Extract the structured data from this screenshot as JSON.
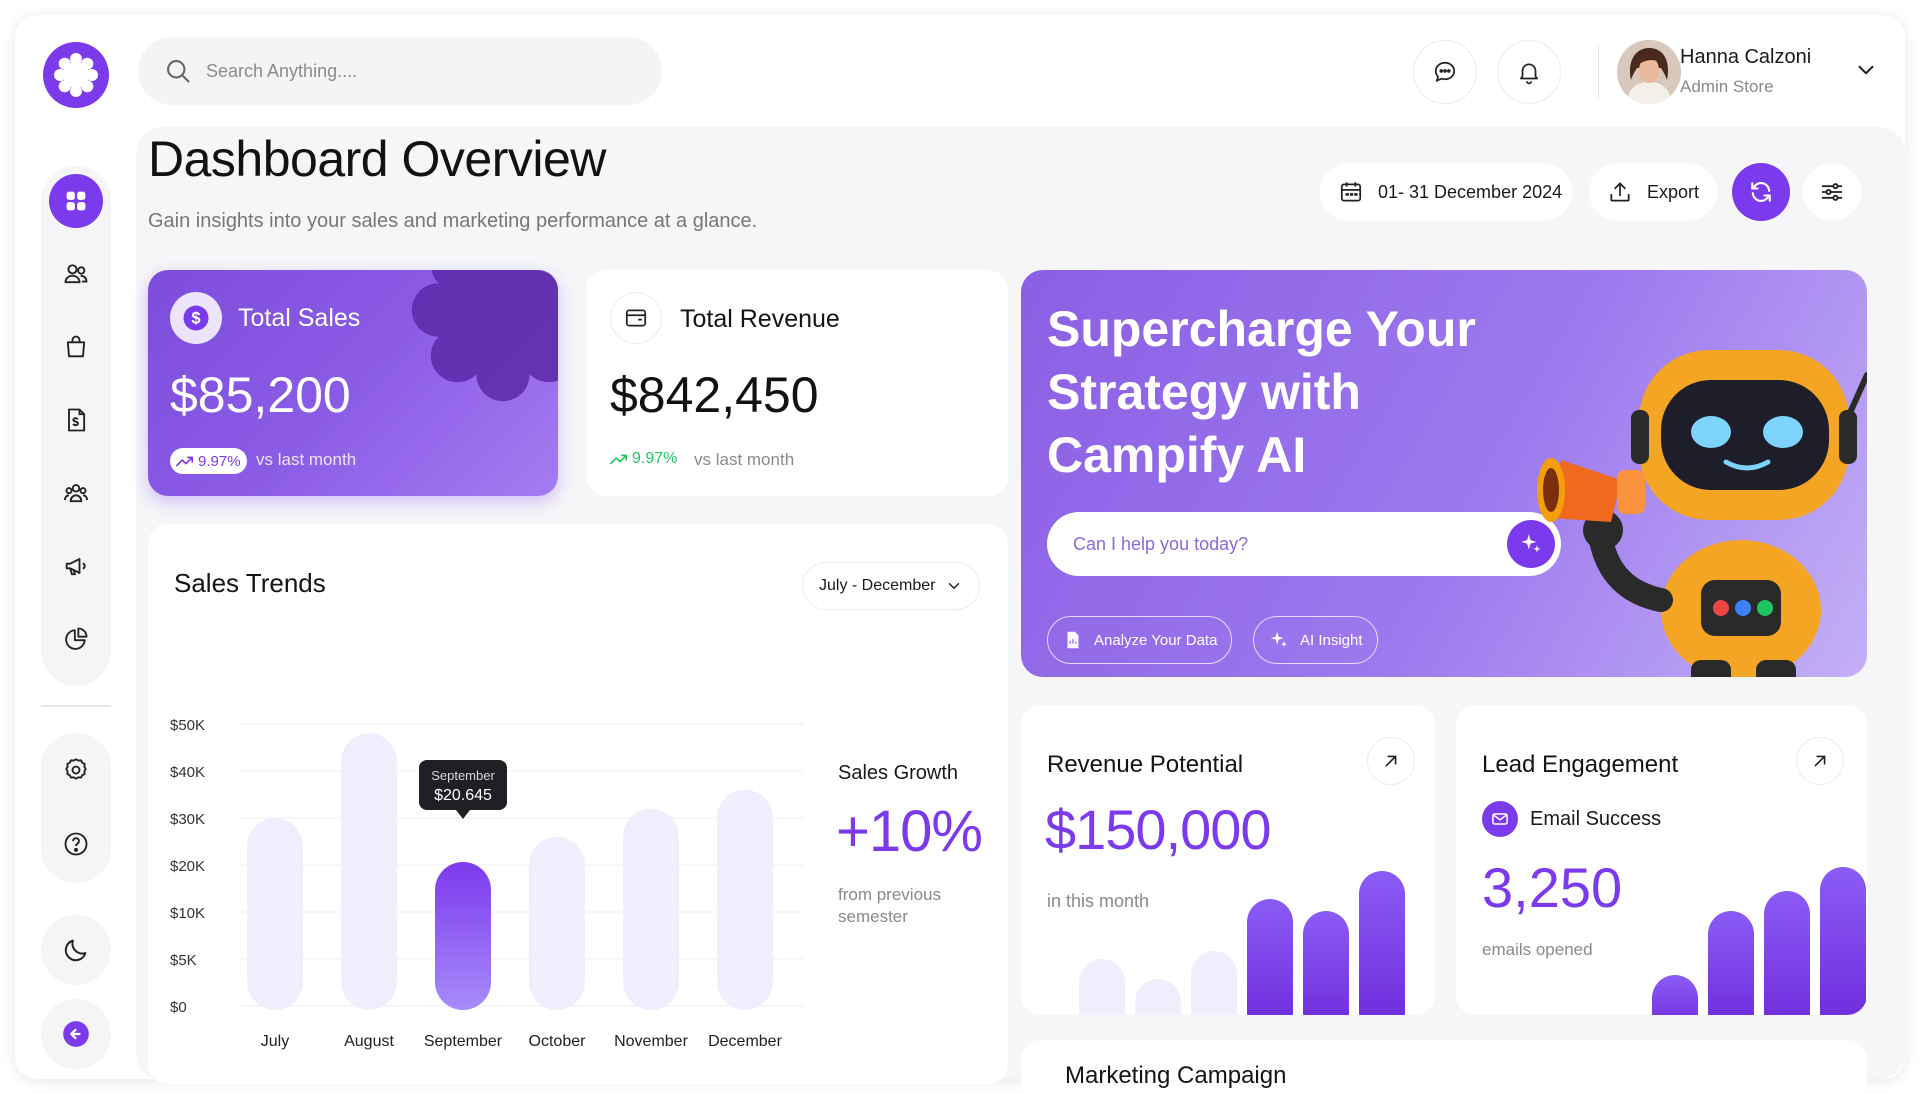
{
  "search": {
    "placeholder": "Search Anything...."
  },
  "user": {
    "name": "Hanna Calzoni",
    "role": "Admin Store"
  },
  "header": {
    "title": "Dashboard Overview",
    "subtitle": "Gain insights into your sales and marketing performance at a glance.",
    "date_range": "01- 31 December 2024",
    "export_label": "Export"
  },
  "total_sales": {
    "label": "Total Sales",
    "value": "$85,200",
    "change": "9.97%",
    "vs": "vs last month"
  },
  "total_revenue": {
    "label": "Total Revenue",
    "value": "$842,450",
    "change": "9.97%",
    "vs": "vs last month"
  },
  "sales_trends": {
    "title": "Sales Trends",
    "range": "July - December",
    "growth_label": "Sales Growth",
    "growth_value": "+10%",
    "growth_note": "from previous semester",
    "tooltip": {
      "month": "September",
      "value": "$20.645"
    }
  },
  "chart_data": {
    "type": "bar",
    "title": "Sales Trends",
    "categories": [
      "July",
      "August",
      "September",
      "October",
      "November",
      "December"
    ],
    "values": [
      30000,
      48000,
      20645,
      26000,
      32000,
      36000
    ],
    "highlight": "September",
    "y_ticks": [
      "$0",
      "$5K",
      "$10K",
      "$20K",
      "$30K",
      "$40K",
      "$50K"
    ],
    "grid": true
  },
  "ai_banner": {
    "title": "Supercharge Your Strategy with Campify AI",
    "input_placeholder": "Can I help you today?",
    "chip_analyze": "Analyze Your Data",
    "chip_insight": "AI Insight"
  },
  "revenue_potential": {
    "title": "Revenue Potential",
    "value": "$150,000",
    "note": "in this month",
    "bars": [
      0.28,
      0.18,
      0.32,
      0.58,
      0.52,
      0.72
    ],
    "highlight_from": 3
  },
  "lead_engagement": {
    "title": "Lead Engagement",
    "badge": "Email Success",
    "value": "3,250",
    "note": "emails opened",
    "bars": [
      0.2,
      0.52,
      0.62,
      0.74
    ],
    "highlight": true
  },
  "marketing": {
    "title": "Marketing Campaign"
  },
  "colors": {
    "accent": "#7c3aed",
    "accent_soft": "#efeefc",
    "positive": "#22c55e"
  },
  "sidebar": {
    "items": [
      "dashboard-icon",
      "users-icon",
      "bag-icon",
      "invoice-icon",
      "team-icon",
      "megaphone-icon",
      "chart-pie-icon"
    ],
    "bottom": [
      "settings-icon",
      "help-icon"
    ]
  }
}
